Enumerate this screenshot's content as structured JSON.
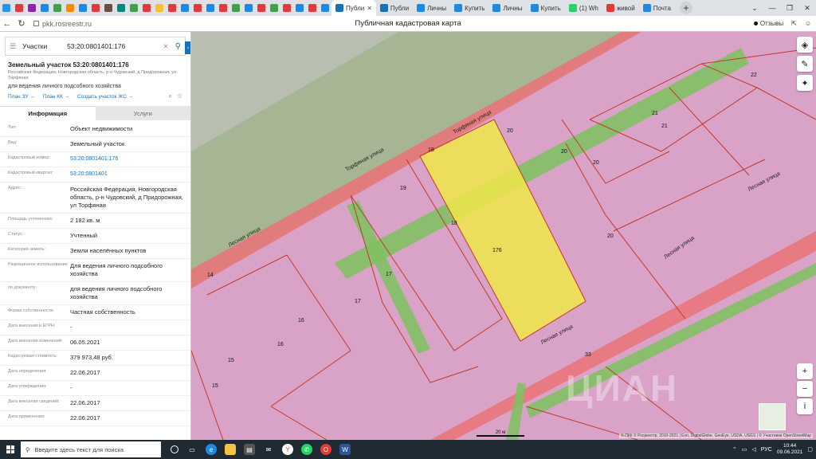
{
  "browser": {
    "tabs": [
      {
        "label": "Публи",
        "active": true
      },
      {
        "label": "Публи",
        "active": false
      },
      {
        "label": "Личны",
        "active": false
      },
      {
        "label": "Купить",
        "active": false
      },
      {
        "label": "Личны",
        "active": false
      },
      {
        "label": "Купить",
        "active": false
      },
      {
        "label": "(1) Wh",
        "active": false
      },
      {
        "label": "живой",
        "active": false
      },
      {
        "label": "Почта",
        "active": false
      }
    ],
    "url": "pkk.rosreestr.ru",
    "page_title": "Публичная кадастровая карта",
    "feedback": "Отзывы"
  },
  "search": {
    "type_label": "Участки",
    "value": "53:20:0801401:176"
  },
  "object": {
    "title": "Земельный участок 53:20:0801401:176",
    "address_short": "Российская Федерация, Новгородская область, р-н Чудовский, д Придорожная, ул Торфяная",
    "use": "для ведения личного подсобного хозяйства",
    "links": [
      "План ЗУ →",
      "План КК →",
      "Создать участок ЖС →"
    ]
  },
  "info_tabs": {
    "info": "Информация",
    "services": "Услуги"
  },
  "rows": [
    {
      "label": "Тип:",
      "value": "Объект недвижимости",
      "link": false
    },
    {
      "label": "Вид:",
      "value": "Земельный участок",
      "link": false
    },
    {
      "label": "Кадастровый номер:",
      "value": "53:20:0801401:176",
      "link": true
    },
    {
      "label": "Кадастровый квартал:",
      "value": "53:20:0801401",
      "link": true
    },
    {
      "label": "Адрес:",
      "value": "Российская Федерация, Новгородская область, р-н Чудовский, д Придорожная, ул Торфяная",
      "link": false
    },
    {
      "label": "Площадь уточненная:",
      "value": "2 182 кв. м",
      "link": false
    },
    {
      "label": "Статус:",
      "value": "Учтенный",
      "link": false
    },
    {
      "label": "Категория земель:",
      "value": "Земли населённых пунктов",
      "link": false
    },
    {
      "label": "Разрешенное использование:",
      "value": "Для ведения личного подсобного хозяйства",
      "link": false
    },
    {
      "label": "по документу:",
      "value": "для ведения личного подсобного хозяйства",
      "link": false
    },
    {
      "label": "Форма собственности:",
      "value": "Частная собственность",
      "link": false
    },
    {
      "label": "Дата внесения в ЕГРН:",
      "value": "-",
      "link": false
    },
    {
      "label": "Дата внесения изменений:",
      "value": "06.05.2021",
      "link": false
    },
    {
      "label": "Кадастровая стоимость:",
      "value": "379 973,48 руб.",
      "link": false
    },
    {
      "label": "Дата определения:",
      "value": "22.06.2017",
      "link": false
    },
    {
      "label": "Дата утверждения:",
      "value": "-",
      "link": false
    },
    {
      "label": "Дата внесения сведений:",
      "value": "22.06.2017",
      "link": false
    },
    {
      "label": "Дата применения:",
      "value": "22.06.2017",
      "link": false
    }
  ],
  "map": {
    "streets": [
      "Торфяная улица",
      "Торфяная улица",
      "Лесная улица",
      "Лесная улица",
      "Лесная улица",
      "Лесная улица"
    ],
    "parcel_numbers": [
      "22",
      "21",
      "21",
      "20",
      "20",
      "20",
      "20",
      "19",
      "18",
      "18",
      "17",
      "17",
      "16",
      "16",
      "15",
      "15",
      "14",
      "176",
      "33"
    ],
    "scale": "20 м",
    "attribution": "© ПКК © Росреестр, 2010-2021 | Esri, DigitalGlobe, GeoEye, USDA, USGS | © Участники OpenStreetMap",
    "watermark": "ЦИАН"
  },
  "taskbar": {
    "search_placeholder": "Введите здесь текст для поиска",
    "lang": "РУС",
    "time": "10:44",
    "date": "09.06.2021"
  },
  "colors": {
    "parcel_fill": "#d9a3c7",
    "selected_parcel": "#f0e84a",
    "road_red": "#e8757a",
    "green_zone": "#7cc25e",
    "accent": "#1a6fb5"
  }
}
